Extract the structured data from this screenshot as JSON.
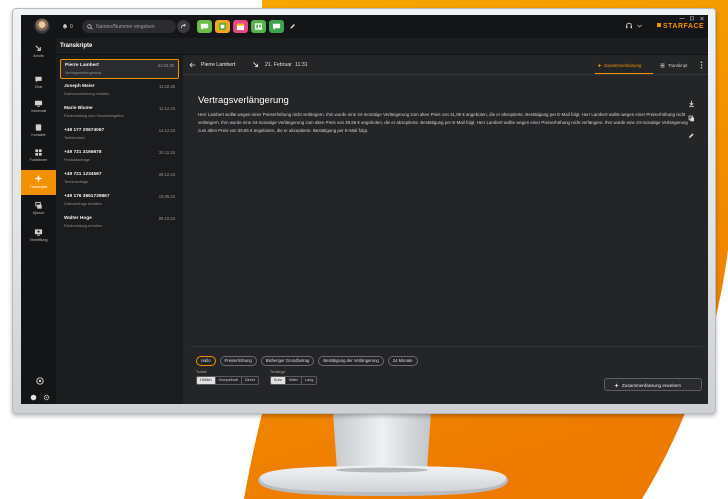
{
  "colors": {
    "accent": "#f39200",
    "app_icons": [
      "#6cbd45",
      "#f5a623",
      "#e5487c",
      "#55b44a",
      "#3fa34d"
    ]
  },
  "app": {
    "logo": "STARFACE"
  },
  "window_controls": [
    "minimize-icon",
    "maximize-icon",
    "close-icon"
  ],
  "topbar": {
    "notification_count": "0",
    "search_placeholder": "Namen/Nummer eingeben",
    "app_icons": [
      "chat-app-icon",
      "sheet-app-icon",
      "calendar-app-icon",
      "board-app-icon",
      "notes-app-icon"
    ]
  },
  "nav": {
    "items": [
      {
        "label": "Anrufe",
        "icon": "phone-arrow-icon"
      },
      {
        "label": "Chat",
        "icon": "chat-bubble-icon"
      },
      {
        "label": "Voicemail",
        "icon": "voicemail-icon"
      },
      {
        "label": "Kontakte",
        "icon": "contacts-icon"
      },
      {
        "label": "Funktionen",
        "icon": "functions-grid-icon"
      },
      {
        "label": "Transcripts",
        "icon": "sparkle-icon",
        "active": true
      },
      {
        "label": "iQueue",
        "icon": "queue-icon"
      },
      {
        "label": "Vermittlung",
        "icon": "operator-icon"
      }
    ]
  },
  "list": {
    "title": "Transkripte",
    "items": [
      {
        "name": "Pierre Lambert",
        "subject": "Vertragsverlängerung",
        "date": "21.02.25"
      },
      {
        "name": "Joseph Meier",
        "subject": "Datenzusicherung erhalten",
        "date": "11.02.25"
      },
      {
        "name": "Marie Blume",
        "subject": "Rückmeldung zum Gesamtangebot",
        "date": "11.12.24"
      },
      {
        "name": "+49 177 20674067",
        "subject": "Tarifwechsel",
        "date": "14.12.24"
      },
      {
        "name": "+49 721 3165678",
        "subject": "Produktanfrage",
        "date": "20.11.24"
      },
      {
        "name": "+49 721 1234567",
        "subject": "Terminanfrage",
        "date": "29.12.24"
      },
      {
        "name": "+49 176 3661739867",
        "subject": "Datenanfrage erhalten",
        "date": "10.05.24"
      },
      {
        "name": "Walter Hoge",
        "subject": "Rückmeldung erhalten",
        "date": "09.10.24"
      }
    ]
  },
  "detail": {
    "contact": "Pierre Lambert",
    "date": "21. Februar",
    "time": "11:31",
    "tab_summary": "Zusammenfassung",
    "tab_transcript": "Transkript",
    "title": "Vertragsverlängerung",
    "body": "Herr Lambert wollte wegen einer Preiserhöhung nicht verlängern. Ihm wurde eine 24-monatige Verlängerung zum alten Preis von 31,95 € angeboten, die er akzeptierte. Bestätigung per E-Mail folgt. Herr Lambert wollte wegen einer Preiserhöhung nicht verlängern. Ihm wurde eine 24-monatige Verlängerung zum alten Preis von 39,95 € angeboten, die er akzeptierte. Bestätigung per E-Mail folgt. Herr Lambert wollte wegen einer Preiserhöhung nicht verlängern. Ihm wurde eine 24-monatige Verlängerung zum alten Preis von 39,95 € angeboten, die er akzeptierte. Bestätigung per E-Mail folgt."
  },
  "keywords": [
    "Hallo",
    "Preiserhöhung",
    "Bisheriger Grundbetrag",
    "Bestätigung der Verlängerung",
    "24 Monate"
  ],
  "options": {
    "tone_label": "Tonfall",
    "tone": [
      "Höflich",
      "Kumpelhaft",
      "Direkt"
    ],
    "length_label": "Textlänge",
    "length": [
      "Kurz",
      "Mittel",
      "Lang"
    ],
    "extend_button": "Zusammenfassung erweitern"
  }
}
